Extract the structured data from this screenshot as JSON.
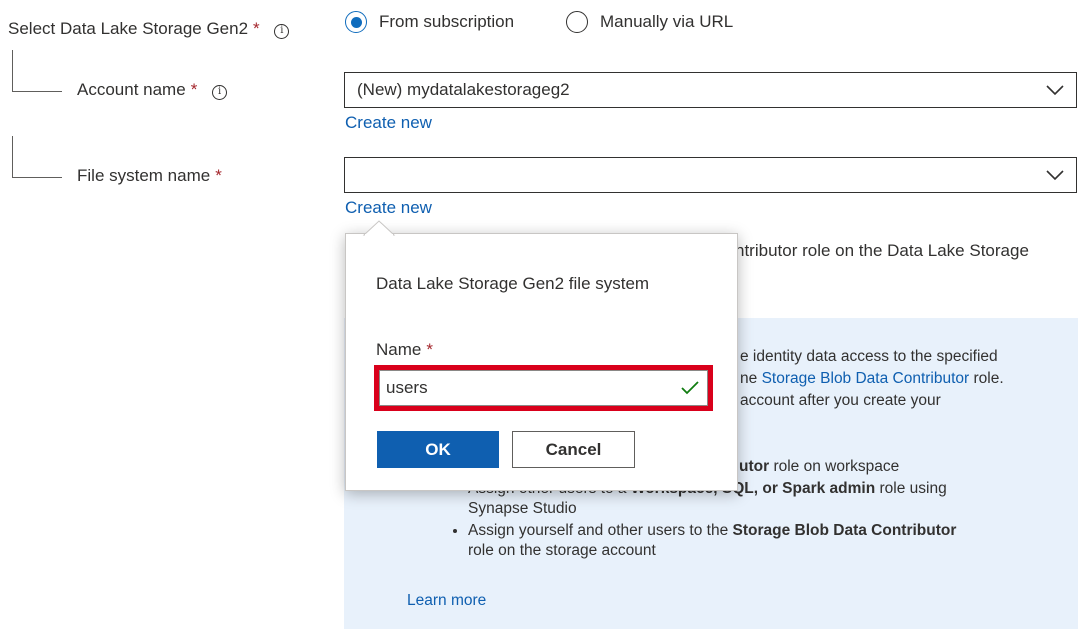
{
  "storage_selector": {
    "label": "Select Data Lake Storage Gen2",
    "required_mark": "*",
    "options": [
      {
        "label": "From subscription",
        "selected": true
      },
      {
        "label": "Manually via URL",
        "selected": false
      }
    ]
  },
  "account": {
    "label": "Account name",
    "required_mark": "*",
    "value": "(New) mydatalakestorageg2",
    "create_new": "Create new"
  },
  "file_system": {
    "label": "File system name",
    "required_mark": "*",
    "value": "",
    "create_new": "Create new"
  },
  "behind_text": "ntributor role on the Data Lake Storage",
  "info_box": {
    "line1": "e identity data access to the specified",
    "line2_prefix": "ne ",
    "line2_link": "Storage Blob Data Contributor",
    "line2_suffix": " role.",
    "line3": "account after you create your",
    "partial_bold": "utor",
    "partial_rest": " role on workspace",
    "bullet1_partial": "Assign other users to a ",
    "bullet1_bold": "Workspace, SQL, or Spark admin",
    "bullet1_suffix": " role using",
    "bullet1_line2": "Synapse Studio",
    "bullet2_prefix": "Assign yourself and other users to the ",
    "bullet2_bold": "Storage Blob Data Contributor",
    "bullet2_suffix": "role on the storage account",
    "learn_more": "Learn more"
  },
  "popup": {
    "title": "Data Lake Storage Gen2 file system",
    "name_label": "Name",
    "required_mark": "*",
    "name_value": "users",
    "ok_label": "OK",
    "cancel_label": "Cancel"
  },
  "colors": {
    "accent": "#0f5fb0",
    "required": "#a4262c",
    "valid_check": "#107c10",
    "highlight": "#d9001b",
    "info_bg": "#e8f1fb"
  }
}
